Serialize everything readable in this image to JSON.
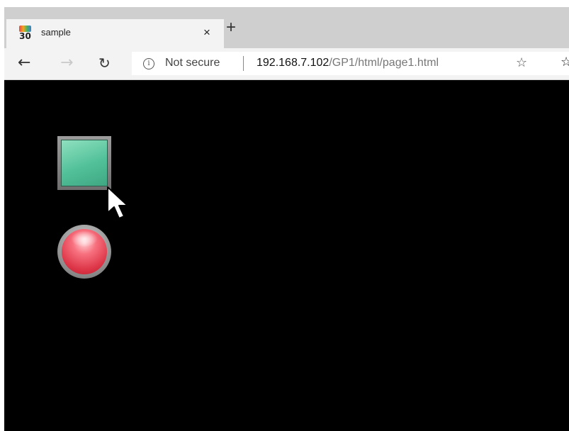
{
  "tab": {
    "favicon_text": "30",
    "title": "sample",
    "close_glyph": "×"
  },
  "new_tab_glyph": "+",
  "nav": {
    "back_glyph": "←",
    "forward_glyph": "→",
    "refresh_glyph": "↻"
  },
  "address": {
    "security_text": "Not secure",
    "url_host": "192.168.7.102",
    "url_path": "/GP1/html/page1.html"
  },
  "toolbar_icons": {
    "favorite": "star-add-icon",
    "favorites_list": "favorites-list-icon"
  },
  "content": {
    "background": "#000000",
    "square_button_color": "#52c19a",
    "lamp_color": "#dc3547"
  }
}
